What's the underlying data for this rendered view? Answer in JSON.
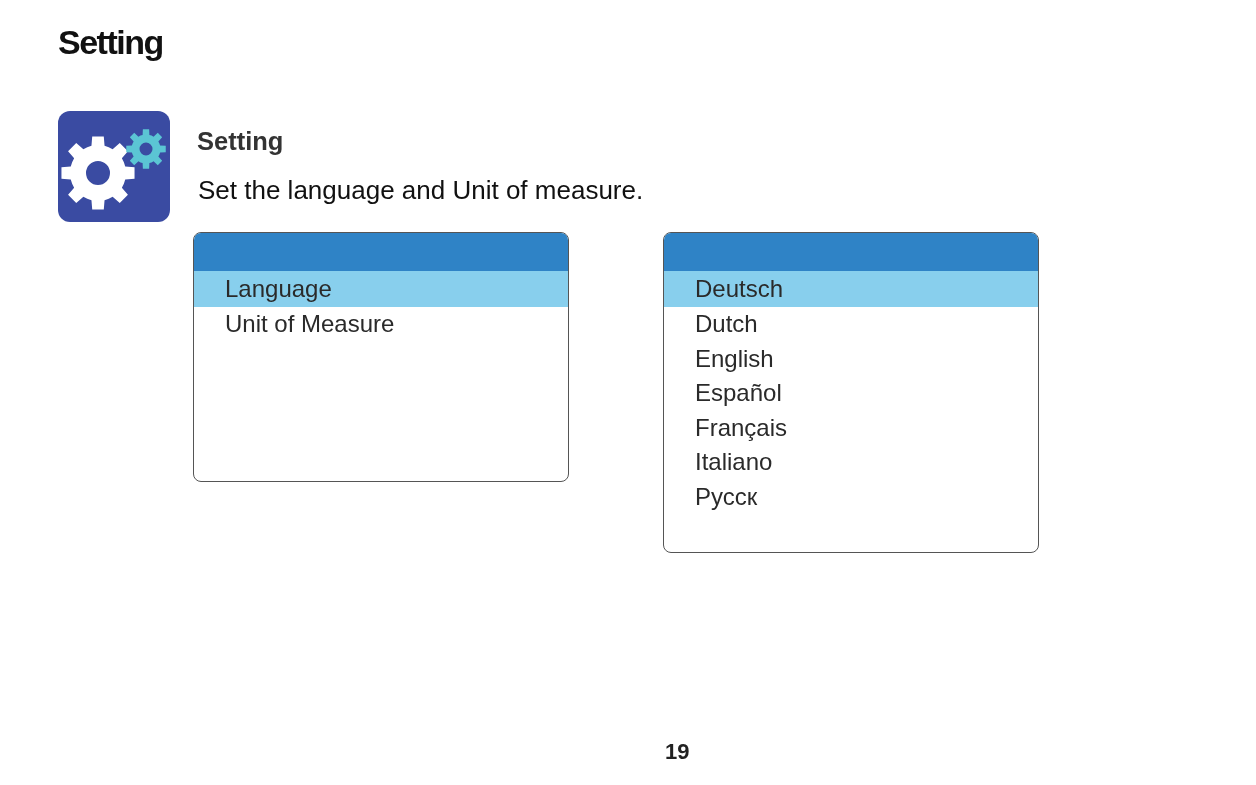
{
  "page_title": "Setting",
  "feature": {
    "title": "Setting",
    "description": "Set the language and Unit of measure."
  },
  "screens": [
    {
      "items": [
        {
          "label": "Language",
          "selected": true
        },
        {
          "label": "Unit of Measure",
          "selected": false
        }
      ]
    },
    {
      "items": [
        {
          "label": "Deutsch",
          "selected": true
        },
        {
          "label": "Dutch",
          "selected": false
        },
        {
          "label": "English",
          "selected": false
        },
        {
          "label": "Español",
          "selected": false
        },
        {
          "label": "Français",
          "selected": false
        },
        {
          "label": "Italiano",
          "selected": false
        },
        {
          "label": "Русск",
          "selected": false
        }
      ]
    }
  ],
  "page_number": "19"
}
